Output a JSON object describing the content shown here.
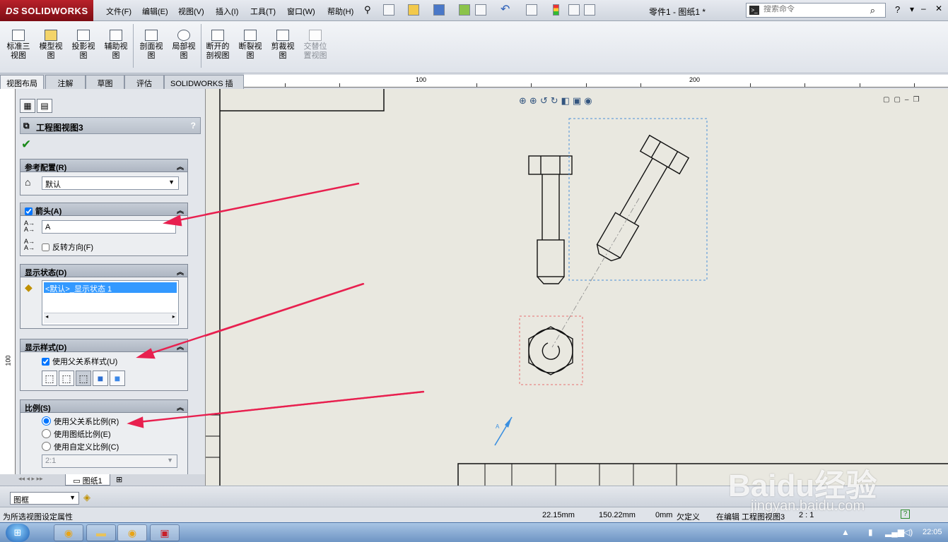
{
  "app": {
    "logo_text": "SOLIDWORKS",
    "logo_ds": "DS",
    "title": "零件1 - 图纸1 *",
    "menus": [
      "文件(F)",
      "编辑(E)",
      "视图(V)",
      "插入(I)",
      "工具(T)",
      "窗口(W)",
      "帮助(H)"
    ],
    "search_placeholder": "搜索命令"
  },
  "command_manager": {
    "buttons": [
      {
        "label": "标准三\n视图",
        "enabled": true
      },
      {
        "label": "模型视\n图",
        "enabled": true
      },
      {
        "label": "投影视\n图",
        "enabled": true
      },
      {
        "label": "辅助视\n图",
        "enabled": true
      },
      {
        "label": "剖面视\n图",
        "enabled": true
      },
      {
        "label": "局部视\n图",
        "enabled": true
      },
      {
        "label": "断开的\n剖视图",
        "enabled": true
      },
      {
        "label": "断裂视\n图",
        "enabled": true
      },
      {
        "label": "剪裁视\n图",
        "enabled": true
      },
      {
        "label": "交替位\n置视图",
        "enabled": false
      }
    ],
    "tabs": [
      "视图布局",
      "注解",
      "草图",
      "评估",
      "SOLIDWORKS 插件"
    ],
    "active_tab": "视图布局"
  },
  "ruler": {
    "top_labels": [
      "100",
      "200"
    ],
    "left_label": "100"
  },
  "property_manager": {
    "title": "工程图视图3",
    "help": "?",
    "reference_config": {
      "title": "参考配置(R)",
      "value": "默认"
    },
    "arrow": {
      "title": "箭头(A)",
      "checked": true,
      "label_value": "A",
      "reverse_label": "反转方向(F)",
      "reverse_checked": false
    },
    "display_state": {
      "title": "显示状态(D)",
      "selected": "<默认>_显示状态 1"
    },
    "display_style": {
      "title": "显示样式(D)",
      "use_parent_label": "使用父关系样式(U)",
      "use_parent_checked": true
    },
    "scale": {
      "title": "比例(S)",
      "options": [
        "使用父关系比例(R)",
        "使用图纸比例(E)",
        "使用自定义比例(C)"
      ],
      "selected_index": 0,
      "custom_value": "2:1"
    }
  },
  "sheet_tab": "图纸1",
  "filter": {
    "value": "图框"
  },
  "status": {
    "hint": "为所选视图设定属性",
    "x": "22.15mm",
    "y": "150.22mm",
    "z": "0mm",
    "state": "欠定义",
    "editing": "在编辑 工程图视图3",
    "scale": "2 : 1"
  },
  "taskbar": {
    "clock": "22:05"
  },
  "watermark": {
    "main": "Baidu经验",
    "sub": "jingyan.baidu.com"
  },
  "canvas": {
    "section_label": "A",
    "colors": {
      "annotation_arrow": "#e8204f",
      "view_border_blue": "#4a90d9",
      "view_border_red": "#e87070",
      "section_arrow": "#3a8fe0"
    }
  }
}
